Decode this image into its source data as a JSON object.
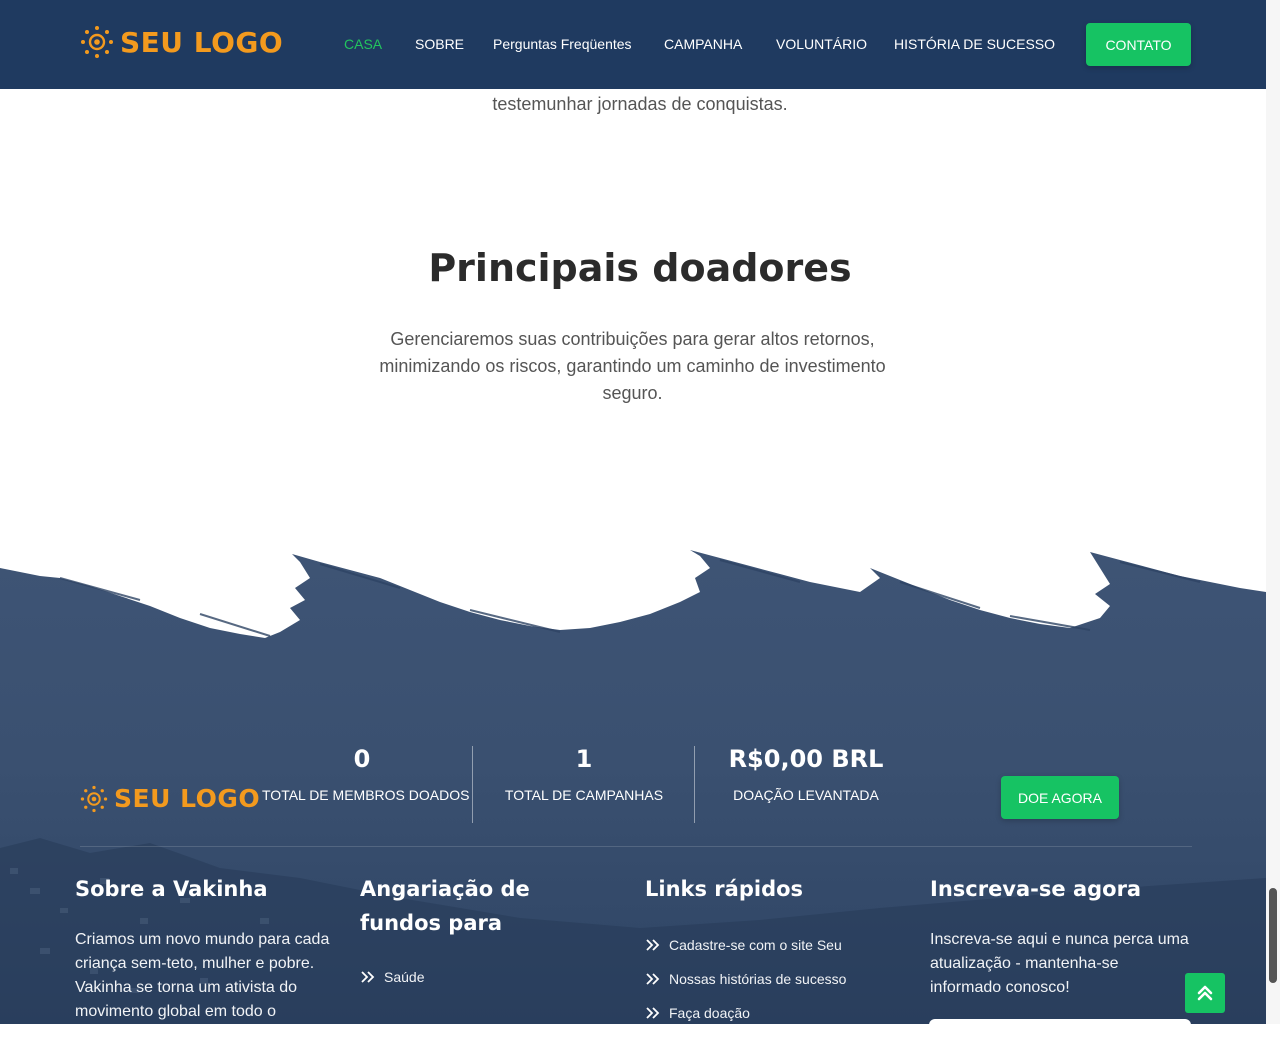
{
  "header": {
    "logo_text": "SEU LOGO",
    "nav": [
      {
        "label": "CASA",
        "active": true
      },
      {
        "label": "SOBRE"
      },
      {
        "label": "Perguntas Freqüentes"
      },
      {
        "label": "CAMPANHA"
      },
      {
        "label": "VOLUNTÁRIO"
      },
      {
        "label": "HISTÓRIA DE SUCESSO"
      }
    ],
    "contact_label": "CONTATO"
  },
  "intro": {
    "tail_text": "testemunhar jornadas de conquistas."
  },
  "top_donors": {
    "title": "Principais doadores",
    "description": "Gerenciaremos suas contribuições para gerar altos retornos, minimizando os riscos, garantindo um caminho de investimento seguro."
  },
  "footer": {
    "logo_text": "SEU LOGO",
    "stats": [
      {
        "value": "0",
        "label": "TOTAL DE MEMBROS DOADOS"
      },
      {
        "value": "1",
        "label": "TOTAL DE CAMPANHAS"
      },
      {
        "value": "R$0,00 BRL",
        "label": "DOAÇÃO LEVANTADA"
      }
    ],
    "donate_label": "DOE AGORA",
    "about": {
      "title": "Sobre a Vakinha",
      "text": "Criamos um novo mundo para cada criança sem-teto, mulher e pobre. Vakinha se torna um ativista do movimento global em todo o"
    },
    "fundraising": {
      "title": "Angariação de fundos para",
      "links": [
        "Saúde"
      ]
    },
    "quick_links": {
      "title": "Links rápidos",
      "links": [
        "Cadastre-se com o site Seu",
        "Nossas histórias de sucesso",
        "Faça doação"
      ]
    },
    "subscribe": {
      "title": "Inscreva-se agora",
      "text": "Inscreva-se aqui e nunca perca uma atualização - mantenha-se informado conosco!"
    }
  },
  "colors": {
    "header_bg": "#1f3a60",
    "accent_green": "#16c363",
    "logo_orange": "#f39a1e",
    "footer_bg": "#3a4f6e"
  },
  "icons": [
    "logo-sun-icon",
    "double-chevron-right-icon",
    "double-chevron-up-icon"
  ]
}
